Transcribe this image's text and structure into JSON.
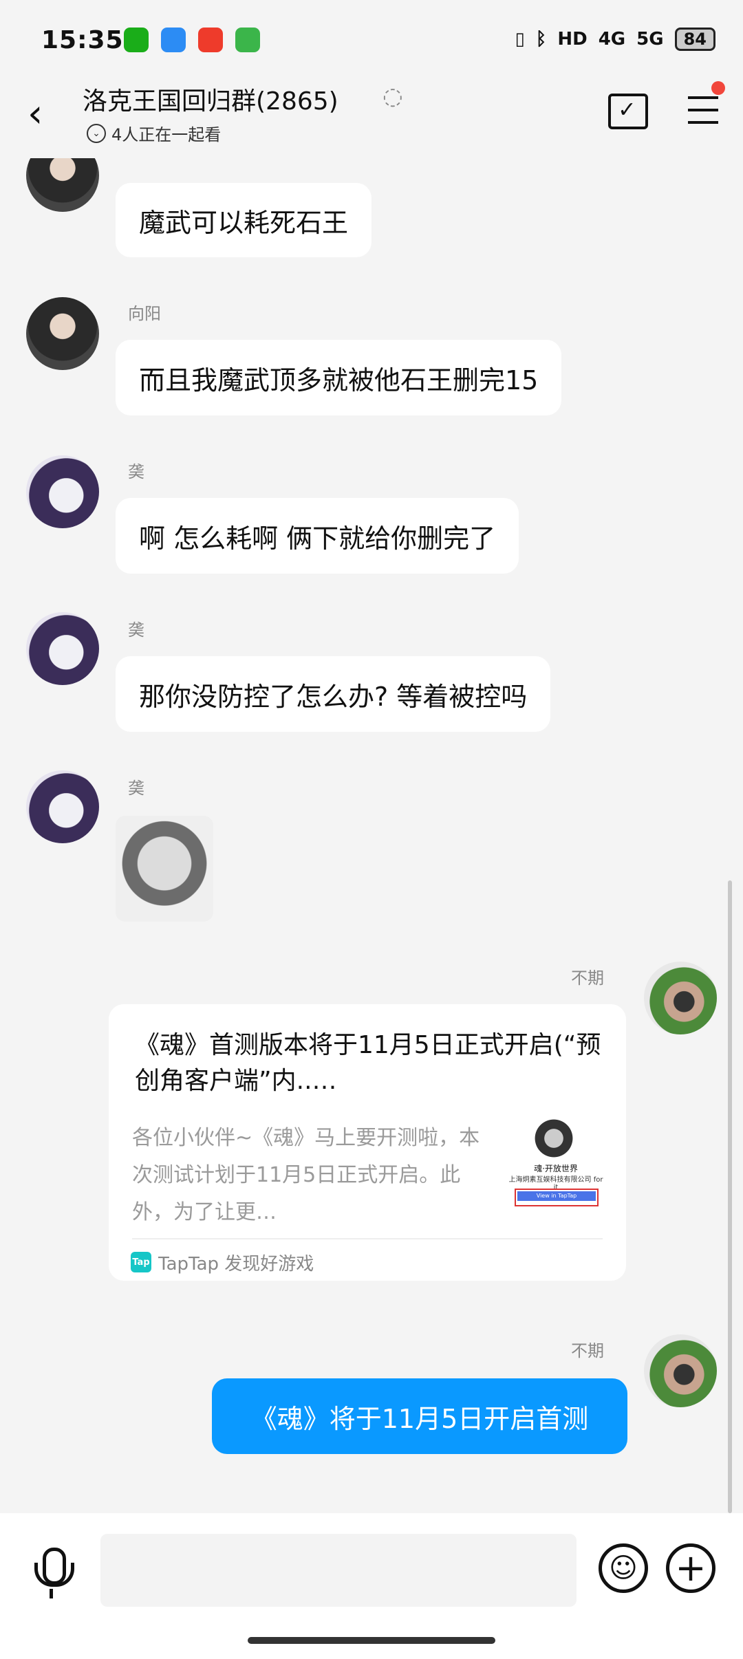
{
  "status_bar": {
    "time": "15:35",
    "app_icons": [
      "wechat-icon",
      "qq-browser-icon",
      "taobao-icon",
      "video-play-icon"
    ],
    "network": "4G",
    "network2": "5G",
    "hd": "HD",
    "battery": "84"
  },
  "header": {
    "group_name": "洛克王国回归群(2865)",
    "watching": "4人正在一起看"
  },
  "messages": [
    {
      "sender": "向阳",
      "text": "魔武可以耗死石王"
    },
    {
      "sender": "向阳",
      "text": "而且我魔武顶多就被他石王删完15"
    },
    {
      "sender": "䶮",
      "text": "啊 怎么耗啊 俩下就给你删完了"
    },
    {
      "sender": "䶮",
      "text": "那你没防控了怎么办? 等着被控吗"
    },
    {
      "sender": "䶮",
      "sticker": "husky-sticker"
    },
    {
      "sender": "不期",
      "card": true
    },
    {
      "sender": "不期",
      "text": "《魂》将于11月5日开启首测"
    }
  ],
  "card": {
    "title": "《魂》首测版本将于11月5日正式开启(“预创角客户端”内..…",
    "desc": "各位小伙伴~《魂》马上要开测啦，本次测试计划于11月5日正式开启。此外，为了让更…",
    "thumb_title": "魂·开放世界",
    "thumb_sub": "上海炯素互娱科技有限公司 for it",
    "thumb_button": "View in TapTap",
    "source_icon": "Tap",
    "source": "TapTap 发现好游戏"
  },
  "input": {
    "placeholder": ""
  }
}
